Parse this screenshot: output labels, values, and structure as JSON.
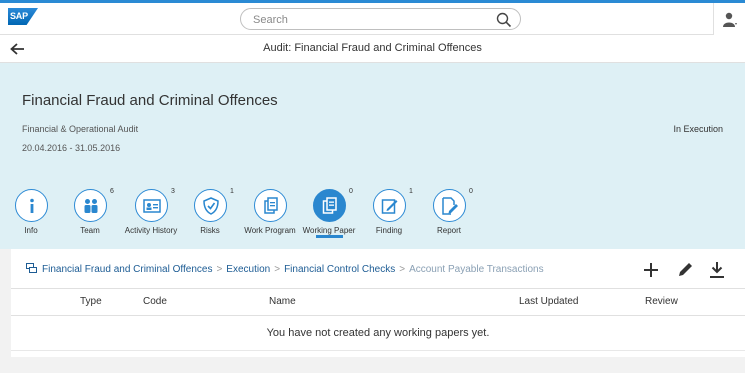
{
  "app": {
    "logo_text": "SAP"
  },
  "search": {
    "placeholder": "Search"
  },
  "nav": {
    "title": "Audit: Financial Fraud and Criminal Offences"
  },
  "header": {
    "title": "Financial Fraud and Criminal Offences",
    "subtitle": "Financial & Operational Audit",
    "dates": "20.04.2016 - 31.05.2016",
    "status": "In Execution"
  },
  "tabs": [
    {
      "label": "Info",
      "count": "",
      "icon": "info-icon",
      "selected": false
    },
    {
      "label": "Team",
      "count": "6",
      "icon": "team-icon",
      "selected": false
    },
    {
      "label": "Activity History",
      "count": "3",
      "icon": "activity-history-icon",
      "selected": false
    },
    {
      "label": "Risks",
      "count": "1",
      "icon": "risk-icon",
      "selected": false
    },
    {
      "label": "Work Program",
      "count": "",
      "icon": "work-program-icon",
      "selected": false
    },
    {
      "label": "Working Paper",
      "count": "0",
      "icon": "working-paper-icon",
      "selected": true
    },
    {
      "label": "Finding",
      "count": "1",
      "icon": "finding-icon",
      "selected": false
    },
    {
      "label": "Report",
      "count": "0",
      "icon": "report-icon",
      "selected": false
    }
  ],
  "breadcrumb": {
    "items": [
      "Financial Fraud and Criminal Offences",
      "Execution",
      "Financial Control Checks"
    ],
    "current": "Account Payable Transactions",
    "separator": ">"
  },
  "toolbar": {
    "icons": [
      "add-icon",
      "edit-icon",
      "download-icon"
    ]
  },
  "table": {
    "columns": [
      "Type",
      "Code",
      "Name",
      "Last Updated",
      "Review"
    ],
    "empty_text": "You have not created any working papers yet."
  },
  "colors": {
    "accent": "#2a87cf",
    "header_bg": "#def0f5",
    "link": "#1d5c94"
  }
}
